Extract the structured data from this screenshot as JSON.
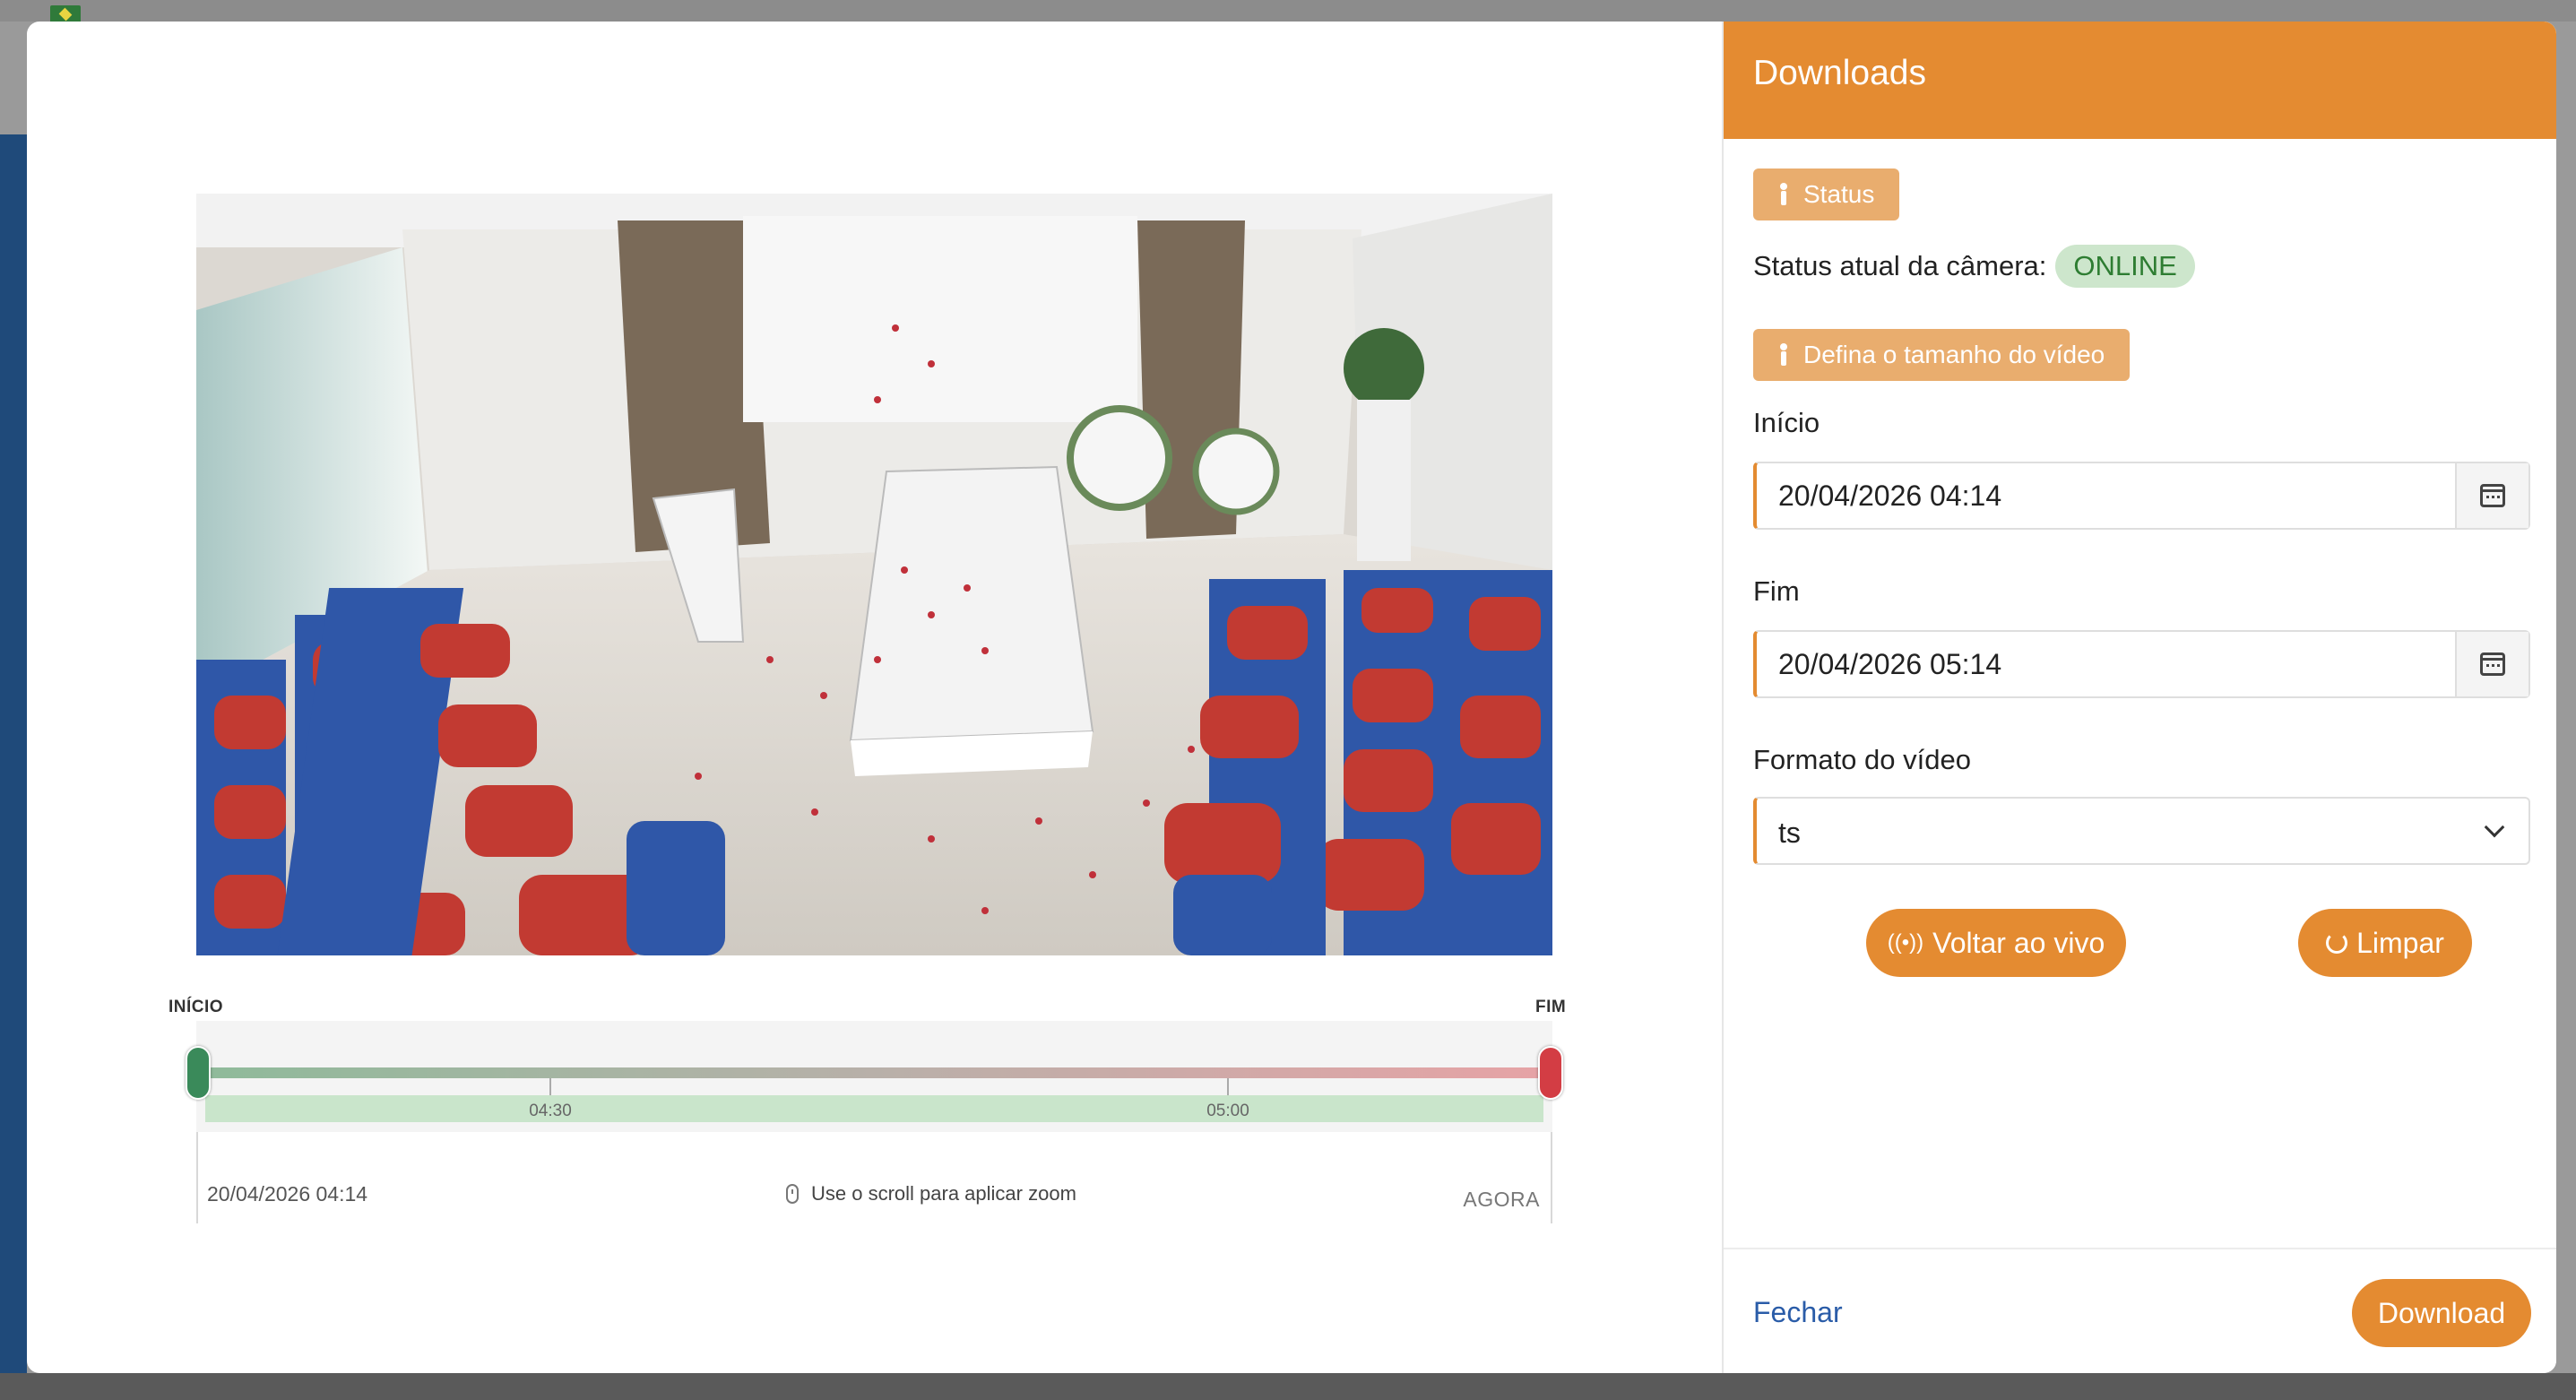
{
  "timeline": {
    "start_marker": "INÍCIO",
    "end_marker": "FIM",
    "tick_labels": [
      "04:30",
      "05:00"
    ],
    "start_datetime": "20/04/2026 04:14",
    "zoom_hint": "Use o scroll para aplicar zoom",
    "now_label": "AGORA"
  },
  "panel": {
    "title": "Downloads",
    "status_chip": "Status",
    "camera_status_label": "Status atual da câmera:",
    "camera_status_value": "ONLINE",
    "size_chip": "Defina o tamanho do vídeo",
    "start_label": "Início",
    "start_value": "20/04/2026 04:14",
    "end_label": "Fim",
    "end_value": "20/04/2026 05:14",
    "format_label": "Formato do vídeo",
    "format_value": "ts",
    "live_button": "Voltar ao vivo",
    "clear_button": "Limpar",
    "close_link": "Fechar",
    "download_button": "Download"
  },
  "colors": {
    "accent": "#e48b31",
    "online": "#2e7d32",
    "start_handle": "#3a8a5a",
    "end_handle": "#d33d44"
  },
  "icons": [
    "flag-icon",
    "person-icon",
    "calendar-icon",
    "chevron-down-icon",
    "live-signal-icon",
    "refresh-icon",
    "mouse-icon"
  ]
}
